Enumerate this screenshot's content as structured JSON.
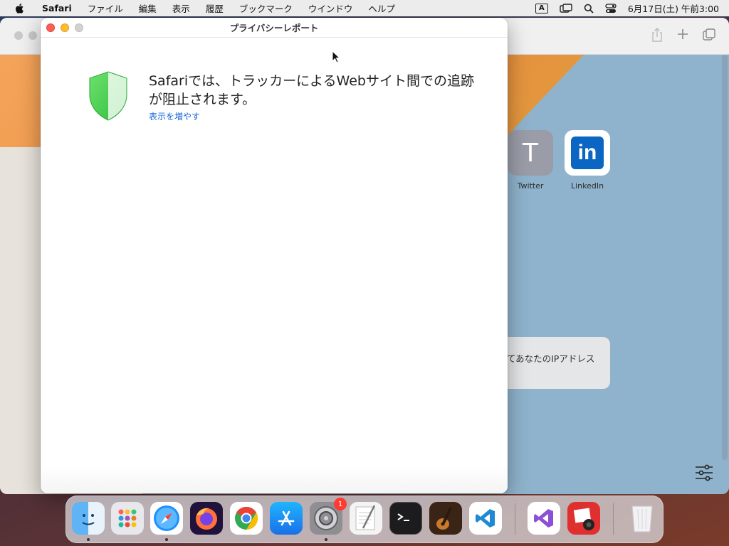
{
  "menubar": {
    "app_name": "Safari",
    "items": [
      "ファイル",
      "編集",
      "表示",
      "履歴",
      "ブックマーク",
      "ウインドウ",
      "ヘルプ"
    ],
    "input_indicator": "A",
    "datetime": "6月17日(土) 午前3:00"
  },
  "safari": {
    "favorites": [
      {
        "label": "Twitter",
        "letter": "T"
      },
      {
        "label": "LinkedIn",
        "letter": "in"
      }
    ],
    "privacy_card_text": "てあなたのIPアドレス"
  },
  "report": {
    "window_title": "プライバシーレポート",
    "headline": "Safariでは、トラッカーによるWebサイト間での追跡が阻止されます。",
    "more_link": "表示を増やす"
  },
  "dock": {
    "apps": [
      "finder",
      "launchpad",
      "safari",
      "firefox",
      "chrome",
      "app-store",
      "system-preferences",
      "textedit",
      "terminal",
      "garageband",
      "vscode",
      "visual-studio",
      "photo-booth",
      "trash"
    ],
    "system_preferences_badge": "1"
  }
}
